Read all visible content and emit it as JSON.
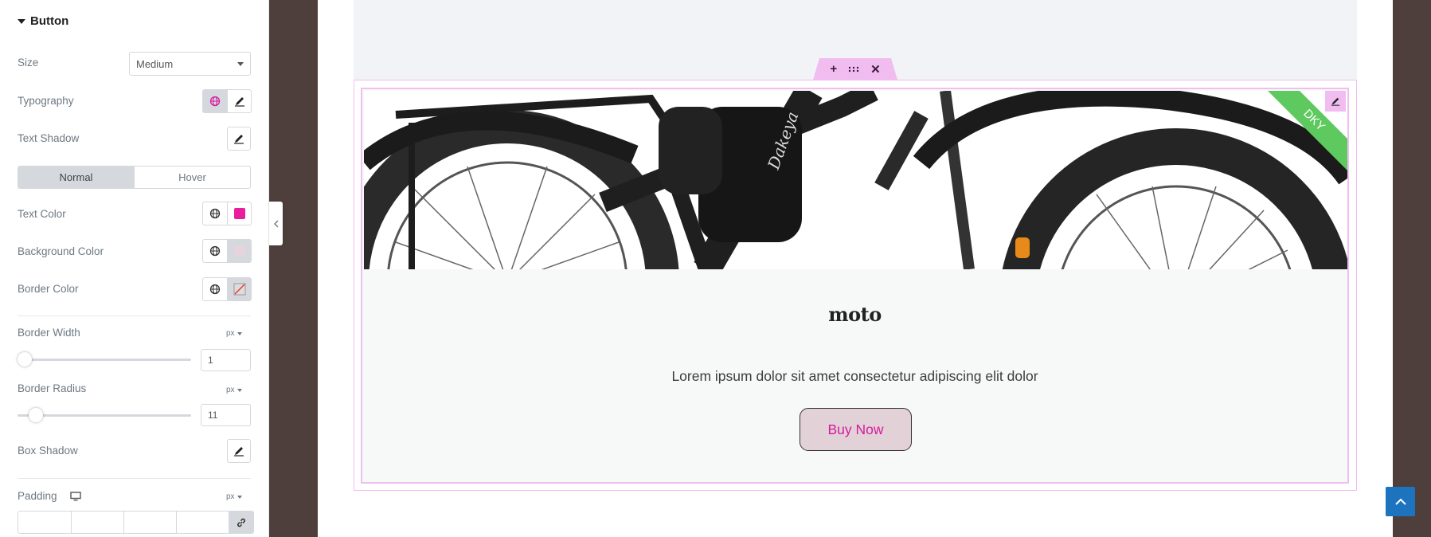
{
  "panel": {
    "section_title": "Button",
    "size": {
      "label": "Size",
      "value": "Medium"
    },
    "typography": {
      "label": "Typography"
    },
    "text_shadow": {
      "label": "Text Shadow"
    },
    "state_tabs": [
      {
        "label": "Normal",
        "active": true
      },
      {
        "label": "Hover",
        "active": false
      }
    ],
    "text_color": {
      "label": "Text Color",
      "swatch": "#e91e9c"
    },
    "background_color": {
      "label": "Background Color",
      "swatch": "#e6d4dc"
    },
    "border_color": {
      "label": "Border Color"
    },
    "border_width": {
      "label": "Border Width",
      "unit": "px",
      "value": "1"
    },
    "border_radius": {
      "label": "Border Radius",
      "unit": "px",
      "value": "11"
    },
    "box_shadow": {
      "label": "Box Shadow"
    },
    "padding": {
      "label": "Padding",
      "unit": "px"
    }
  },
  "card": {
    "ribbon": "DKY",
    "brand": "Dakeya",
    "title": "moto",
    "description": "Lorem ipsum dolor sit amet consectetur adipiscing elit dolor",
    "button_label": "Buy Now"
  },
  "colors": {
    "accent_pink": "#f1bdf1",
    "button_text": "#d61a9e",
    "button_bg": "#e2d2d8",
    "ribbon": "#5ec95e",
    "scroll_top": "#1e73be"
  },
  "icons": [
    "caret-down-icon",
    "globe-icon",
    "pencil-icon",
    "chevron-left-icon",
    "plus-icon",
    "drag-grid-icon",
    "close-icon",
    "desktop-icon",
    "link-icon",
    "chevron-up-icon"
  ]
}
